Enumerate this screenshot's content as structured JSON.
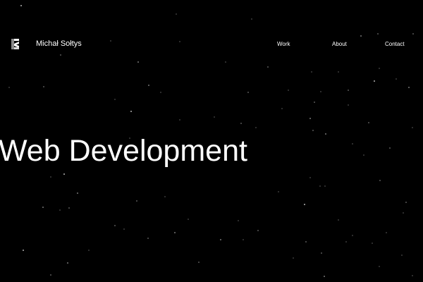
{
  "page": {
    "background_color": "#000000",
    "text_color": "#ffffff",
    "star_color": "#ffffff"
  },
  "header": {
    "logo_icon": "monogram-logo-icon",
    "brand_name": "Michał Sołtys",
    "nav": {
      "work_label": "Work",
      "about_label": "About",
      "contact_label": "Contact"
    }
  },
  "hero": {
    "title": "Web Development"
  }
}
